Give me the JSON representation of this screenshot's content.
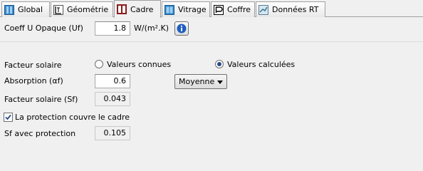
{
  "tabs": [
    {
      "label": "Global",
      "icon": "global-icon"
    },
    {
      "label": "Géométrie",
      "icon": "geometry-icon"
    },
    {
      "label": "Cadre",
      "icon": "frame-icon",
      "active": true
    },
    {
      "label": "Vitrage",
      "icon": "glazing-icon"
    },
    {
      "label": "Coffre",
      "icon": "box-icon"
    },
    {
      "label": "Données RT",
      "icon": "rt-data-icon"
    }
  ],
  "coeff": {
    "label": "Coeff U Opaque (Uf)",
    "value": "1.8",
    "unit": "W/(m².K)"
  },
  "solar": {
    "label": "Facteur solaire",
    "option_known": "Valeurs connues",
    "option_calculated": "Valeurs calculées",
    "selected": "calculated"
  },
  "absorption": {
    "label": "Absorption (αf)",
    "value": "0.6",
    "dropdown_value": "Moyenne"
  },
  "sf": {
    "label": "Facteur solaire (Sf)",
    "value": "0.043"
  },
  "protection": {
    "label": "La protection couvre le cadre",
    "checked": true
  },
  "sf_protection": {
    "label": "Sf avec protection",
    "value": "0.105"
  },
  "colors": {
    "accent": "#2a4a8a",
    "info_blue": "#1f5fbf",
    "frame_red": "#8b1a1a"
  }
}
